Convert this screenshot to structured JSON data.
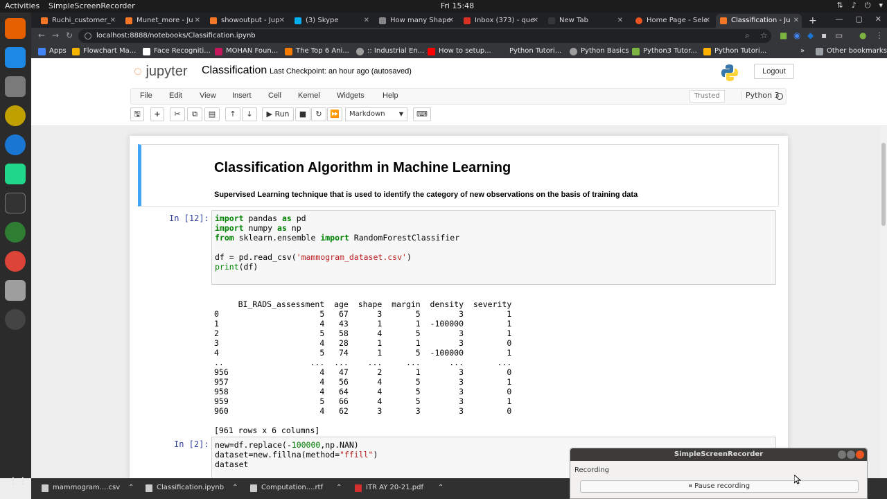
{
  "topbar": {
    "activities": "Activities",
    "app": "SimpleScreenRecorder",
    "clock": "Fri 15:48"
  },
  "browser": {
    "tabs": [
      {
        "label": "Ruchi_customer_",
        "color": "#f37726"
      },
      {
        "label": "Munet_more - Ju",
        "color": "#f37726"
      },
      {
        "label": "showoutput - Jup",
        "color": "#f37726"
      },
      {
        "label": "(3) Skype",
        "color": "#00aff0"
      },
      {
        "label": "How many Shape",
        "color": "#888888"
      },
      {
        "label": "Inbox (373) - que",
        "color": "#d93025"
      },
      {
        "label": "New Tab",
        "color": "#35363a"
      },
      {
        "label": "Home Page - Sele",
        "color": "#e95420"
      },
      {
        "label": "Classification - Ju",
        "color": "#f37726"
      }
    ],
    "url": "localhost:8888/notebooks/Classification.ipynb",
    "bookmarks": [
      {
        "label": "Apps",
        "color": "#4285f4"
      },
      {
        "label": "Flowchart Ma...",
        "color": "#f4b400"
      },
      {
        "label": "Face Recogniti...",
        "color": "#ffffff"
      },
      {
        "label": "MOHAN Foun...",
        "color": "#c2185b"
      },
      {
        "label": "The Top 6 Ani...",
        "color": "#f57c00"
      },
      {
        "label": ":: Industrial En...",
        "color": "#9e9e9e"
      },
      {
        "label": "How to setup...",
        "color": "#ff0000"
      },
      {
        "label": "Python Tutori...",
        "color": "#35363a"
      },
      {
        "label": "Python Basics",
        "color": "#9e9e9e"
      },
      {
        "label": "Python3 Tutor...",
        "color": "#7cb342"
      },
      {
        "label": "Python Tutori...",
        "color": "#ffb300"
      }
    ],
    "other_bookmarks": "Other bookmarks"
  },
  "jupyter": {
    "logo_pre": "jupyter",
    "notebook_title": "Classification",
    "checkpoint": "Last Checkpoint: an hour ago  (autosaved)",
    "logout": "Logout",
    "menu": [
      "File",
      "Edit",
      "View",
      "Insert",
      "Cell",
      "Kernel",
      "Widgets",
      "Help"
    ],
    "trusted": "Trusted",
    "kernel": "Python 3",
    "toolbar": {
      "run": "Run",
      "cell_type": "Markdown"
    }
  },
  "cells": {
    "md_title": "Classification Algorithm in Machine Learning",
    "md_sub": "Supervised Learning technique that is used to identify the category of new observations on the basis of training data",
    "c1_prompt": "In [12]:",
    "c2_prompt": "In [2]:",
    "output": "     BI_RADS_assessment  age  shape  margin  density  severity\n0                     5   67      3       5        3         1\n1                     4   43      1       1  -100000         1\n2                     5   58      4       5        3         1\n3                     4   28      1       1        3         0\n4                     5   74      1       5  -100000         1\n..                  ...  ...    ...     ...      ...       ...\n956                   4   47      2       1        3         0\n957                   4   56      4       5        3         1\n958                   4   64      4       5        3         0\n959                   5   66      4       5        3         1\n960                   4   62      3       3        3         0\n\n[961 rows x 6 columns]"
  },
  "taskbar": [
    {
      "label": "mammogram....csv"
    },
    {
      "label": "Classification.ipynb"
    },
    {
      "label": "Computation....rtf"
    },
    {
      "label": "ITR AY 20-21.pdf"
    }
  ],
  "recorder": {
    "title": "SimpleScreenRecorder",
    "status": "Recording",
    "pause": "Pause recording"
  }
}
